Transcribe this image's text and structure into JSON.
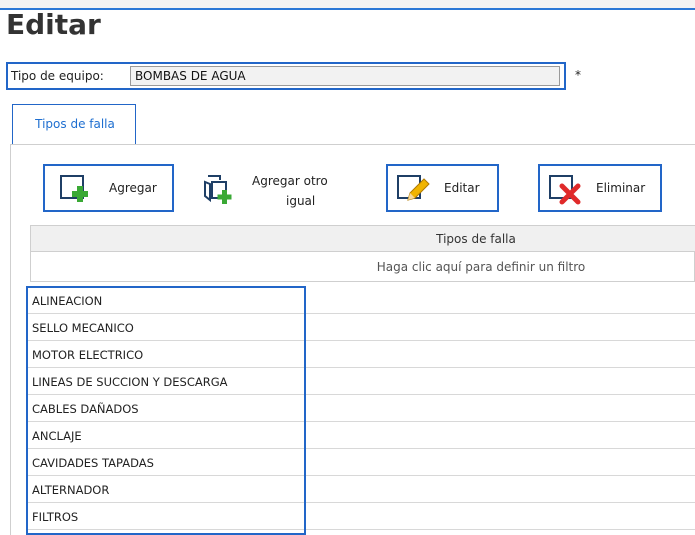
{
  "window": {
    "title": "Editar"
  },
  "form": {
    "equipment_label": "Tipo de equipo:",
    "equipment_value": "BOMBAS DE AGUA",
    "required_mark": "*"
  },
  "tabs": [
    {
      "label": "Tipos de falla",
      "active": true
    }
  ],
  "toolbar": {
    "add_label": "Agregar",
    "add_same_label_line1": "Agregar otro",
    "add_same_label_line2": "igual",
    "edit_label": "Editar",
    "delete_label": "Eliminar"
  },
  "grid": {
    "column_header": "Tipos de falla",
    "filter_hint": "Haga clic aquí para definir un filtro",
    "rows": [
      "ALINEACION",
      "SELLO MECANICO",
      "MOTOR ELECTRICO",
      "LINEAS DE SUCCION Y DESCARGA",
      "CABLES DAÑADOS",
      "ANCLAJE",
      "CAVIDADES TAPADAS",
      "ALTERNADOR",
      "FILTROS"
    ]
  },
  "colors": {
    "accent": "#2266c8",
    "add_green": "#3aa935",
    "delete_red": "#e02a2a",
    "edit_yellow": "#f0b400"
  }
}
